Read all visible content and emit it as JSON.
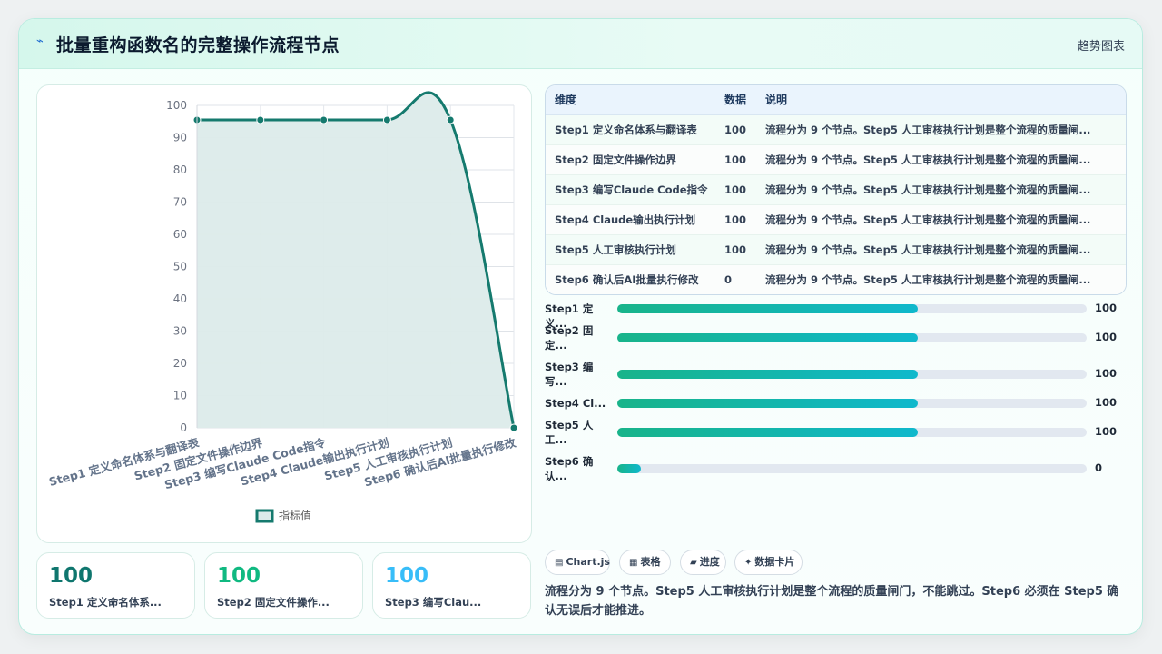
{
  "header": {
    "icon": "lightning-icon",
    "title": "批量重构函数名的完整操作流程节点",
    "tag": "趋势图表"
  },
  "chart_data": {
    "type": "area",
    "categories": [
      "Step1 定义命名体系与翻译表",
      "Step2 固定文件操作边界",
      "Step3 编写Claude Code指令",
      "Step4 Claude输出执行计划",
      "Step5 人工审核执行计划",
      "Step6 确认后AI批量执行修改"
    ],
    "series": [
      {
        "name": "指标值",
        "values": [
          95.5,
          95.5,
          95.5,
          95.5,
          95.5,
          0
        ]
      }
    ],
    "ylim": [
      0,
      100
    ],
    "yticks": [
      0,
      10,
      20,
      30,
      40,
      50,
      60,
      70,
      80,
      90,
      100
    ],
    "grid": true,
    "legend": "bottom",
    "colors": {
      "line": "#157a6e",
      "fill": "#dcebea"
    }
  },
  "stats": [
    {
      "value": "100",
      "label": "Step1 定义命名体系...",
      "color": "#0f766e"
    },
    {
      "value": "100",
      "label": "Step2 固定文件操作...",
      "color": "#10b981"
    },
    {
      "value": "100",
      "label": "Step3 编写Clau...",
      "color": "#38bdf8"
    }
  ],
  "table": {
    "headers": [
      "维度",
      "数据",
      "说明"
    ],
    "rows": [
      {
        "name": "Step1 定义命名体系与翻译表",
        "value": "100",
        "desc": "流程分为 9 个节点。Step5 人工审核执行计划是整个流程的质量闸..."
      },
      {
        "name": "Step2 固定文件操作边界",
        "value": "100",
        "desc": "流程分为 9 个节点。Step5 人工审核执行计划是整个流程的质量闸..."
      },
      {
        "name": "Step3 编写Claude Code指令",
        "value": "100",
        "desc": "流程分为 9 个节点。Step5 人工审核执行计划是整个流程的质量闸..."
      },
      {
        "name": "Step4 Claude输出执行计划",
        "value": "100",
        "desc": "流程分为 9 个节点。Step5 人工审核执行计划是整个流程的质量闸..."
      },
      {
        "name": "Step5 人工审核执行计划",
        "value": "100",
        "desc": "流程分为 9 个节点。Step5 人工审核执行计划是整个流程的质量闸..."
      },
      {
        "name": "Step6 确认后AI批量执行修改",
        "value": "0",
        "desc": "流程分为 9 个节点。Step5 人工审核执行计划是整个流程的质量闸..."
      }
    ]
  },
  "progress": [
    {
      "label_line1": "Step1 定义...",
      "label_line2": "",
      "value": "100",
      "fill": 0.64
    },
    {
      "label_line1": "Step2 固",
      "label_line2": "定...",
      "value": "100",
      "fill": 0.64
    },
    {
      "label_line1": "Step3 编",
      "label_line2": "写...",
      "value": "100",
      "fill": 0.64
    },
    {
      "label_line1": "Step4 Cl...",
      "label_line2": "",
      "value": "100",
      "fill": 0.64
    },
    {
      "label_line1": "Step5 人",
      "label_line2": "工...",
      "value": "100",
      "fill": 0.64
    },
    {
      "label_line1": "Step6 确",
      "label_line2": "认...",
      "value": "0",
      "fill": 0.05
    }
  ],
  "chips": [
    {
      "icon": "chart-icon",
      "glyph": "▤",
      "label": "Chart.js"
    },
    {
      "icon": "table-icon",
      "glyph": "▦",
      "label": "表格"
    },
    {
      "icon": "progress-icon",
      "glyph": "▰",
      "label": "进度"
    },
    {
      "icon": "sparkle-icon",
      "glyph": "✦",
      "label": "数据卡片"
    }
  ],
  "summary": "流程分为 9 个节点。Step5 人工审核执行计划是整个流程的质量闸门，不能跳过。Step6 必须在 Step5 确认无误后才能推进。"
}
